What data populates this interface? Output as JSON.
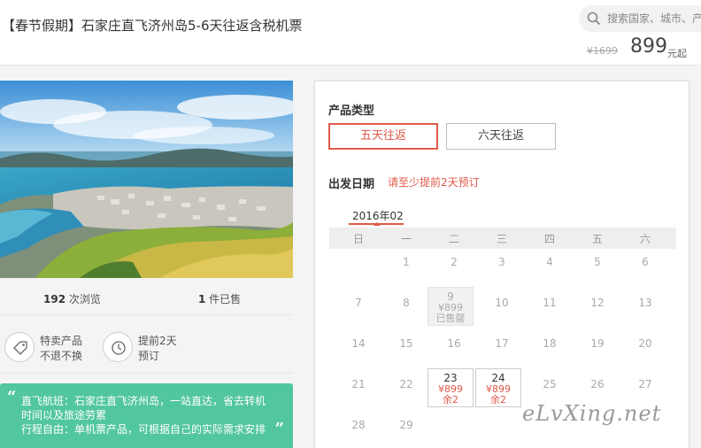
{
  "header": {
    "title": "【春节假期】石家庄直飞济州岛5-6天往返含税机票",
    "search_placeholder": "搜索国家、城市、产品",
    "price_old": "¥1699",
    "price_now": "899",
    "price_unit": "元起"
  },
  "left": {
    "stats": [
      {
        "num": "192",
        "label": " 次浏览"
      },
      {
        "num": "1",
        "label": " 件已售"
      }
    ],
    "features": [
      {
        "line1": "特卖产品",
        "line2": "不退不换",
        "icon": "tag-icon"
      },
      {
        "line1": "提前2天",
        "line2": "预订",
        "icon": "clock-icon"
      }
    ],
    "notice": [
      "直飞航班：石家庄直飞济州岛，一站直达，省去转机",
      "时间以及旅途劳累",
      "行程自由：单机票产品，可根据自己的实际需求安排"
    ]
  },
  "booking": {
    "product_type_label": "产品类型",
    "options": [
      "五天往返",
      "六天往返"
    ],
    "selected_option": 0,
    "departure_label": "出发日期",
    "departure_hint": "请至少提前2天预订",
    "month": "2016年02",
    "weekdays": [
      "日",
      "一",
      "二",
      "三",
      "四",
      "五",
      "六"
    ],
    "days": [
      {
        "day": "1",
        "col": 1,
        "row": 0
      },
      {
        "day": "2",
        "col": 2,
        "row": 0
      },
      {
        "day": "3",
        "col": 3,
        "row": 0
      },
      {
        "day": "4",
        "col": 4,
        "row": 0
      },
      {
        "day": "5",
        "col": 5,
        "row": 0
      },
      {
        "day": "6",
        "col": 6,
        "row": 0
      },
      {
        "day": "7",
        "col": 0,
        "row": 1
      },
      {
        "day": "8",
        "col": 1,
        "row": 1
      },
      {
        "day": "9",
        "col": 2,
        "row": 1,
        "state": "soldout",
        "price": "¥899",
        "status": "已售罄"
      },
      {
        "day": "10",
        "col": 3,
        "row": 1
      },
      {
        "day": "11",
        "col": 4,
        "row": 1
      },
      {
        "day": "12",
        "col": 5,
        "row": 1
      },
      {
        "day": "13",
        "col": 6,
        "row": 1
      },
      {
        "day": "14",
        "col": 0,
        "row": 2
      },
      {
        "day": "15",
        "col": 1,
        "row": 2
      },
      {
        "day": "16",
        "col": 2,
        "row": 2
      },
      {
        "day": "17",
        "col": 3,
        "row": 2
      },
      {
        "day": "18",
        "col": 4,
        "row": 2
      },
      {
        "day": "19",
        "col": 5,
        "row": 2
      },
      {
        "day": "20",
        "col": 6,
        "row": 2
      },
      {
        "day": "21",
        "col": 0,
        "row": 3
      },
      {
        "day": "22",
        "col": 1,
        "row": 3
      },
      {
        "day": "23",
        "col": 2,
        "row": 3,
        "state": "avail",
        "price": "¥899",
        "status": "余2"
      },
      {
        "day": "24",
        "col": 3,
        "row": 3,
        "state": "avail",
        "price": "¥899",
        "status": "余2"
      },
      {
        "day": "25",
        "col": 4,
        "row": 3
      },
      {
        "day": "26",
        "col": 5,
        "row": 3
      },
      {
        "day": "27",
        "col": 6,
        "row": 3
      },
      {
        "day": "28",
        "col": 0,
        "row": 4
      },
      {
        "day": "29",
        "col": 1,
        "row": 4
      }
    ]
  },
  "watermark": "eLvXing.net",
  "colors": {
    "accent": "#e05a4a",
    "notice_bg": "#52c6a0"
  }
}
